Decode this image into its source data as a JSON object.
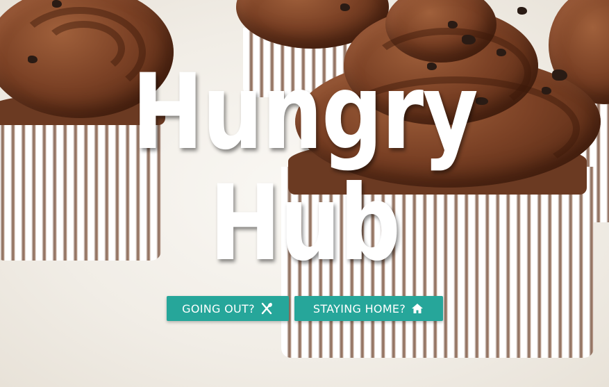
{
  "hero": {
    "title_line1": "Hungry",
    "title_line2": "Hub"
  },
  "buttons": {
    "going_out": {
      "label": "GOING OUT?",
      "icon": "utensils-icon"
    },
    "staying_home": {
      "label": "STAYING HOME?",
      "icon": "home-icon"
    }
  },
  "colors": {
    "button_bg": "#26a69a",
    "button_text": "#ffffff",
    "title": "#ffffff",
    "frosting": "#7b4125"
  }
}
